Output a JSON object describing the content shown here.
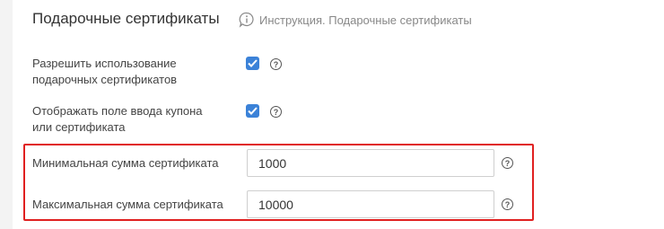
{
  "section": {
    "title": "Подарочные сертификаты",
    "help_link": "Инструкция. Подарочные сертификаты"
  },
  "settings": [
    {
      "label_line1": "Разрешить использование",
      "label_line2": "подарочных сертификатов",
      "checked": true,
      "help": "?"
    },
    {
      "label_line1": "Отображать поле ввода купона",
      "label_line2": "или сертификата",
      "checked": true,
      "help": "?"
    }
  ],
  "fields": [
    {
      "label": "Минимальная сумма сертификата",
      "value": "1000",
      "help": "?"
    },
    {
      "label": "Максимальная сумма сертификата",
      "value": "10000",
      "help": "?"
    }
  ],
  "colors": {
    "accent": "#3b82d8",
    "highlight": "#e02020"
  }
}
